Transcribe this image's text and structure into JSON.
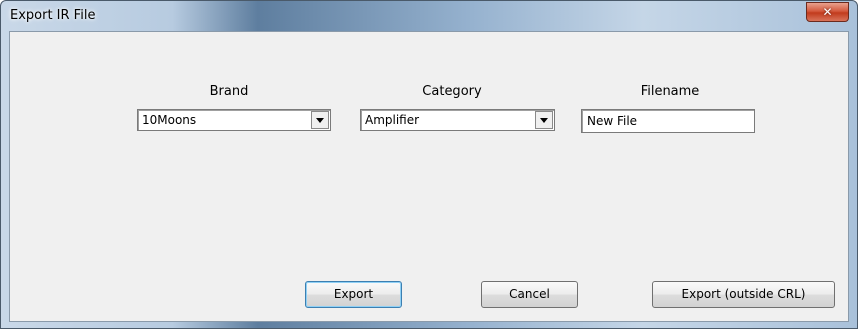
{
  "window": {
    "title": "Export IR File"
  },
  "brand": {
    "label": "Brand",
    "selected": "10Moons"
  },
  "category": {
    "label": "Category",
    "selected": "Amplifier"
  },
  "filename": {
    "label": "Filename",
    "value": "New File"
  },
  "buttons": {
    "export": "Export",
    "cancel": "Cancel",
    "export_outside": "Export (outside CRL)"
  },
  "icons": {
    "close": "close-icon",
    "dropdown": "chevron-down-icon"
  }
}
